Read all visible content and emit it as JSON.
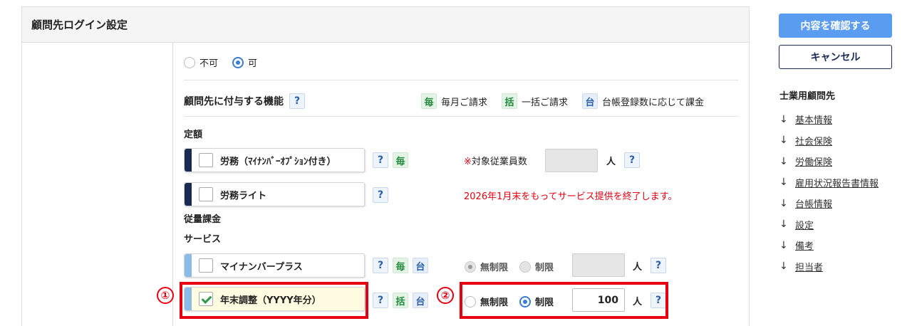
{
  "panel": {
    "title": "顧問先ログイン設定"
  },
  "login_options": {
    "disabled_label": "不可",
    "enabled_label": "可",
    "selected": "可"
  },
  "features": {
    "label": "顧問先に付与する機能",
    "legend": [
      {
        "badge": "毎",
        "text": "毎月ご請求",
        "color": "#1f8a3a"
      },
      {
        "badge": "括",
        "text": "一括ご請求",
        "color": "#1f8a3a"
      },
      {
        "badge": "台",
        "text": "台帳登録数に応じて課金",
        "color": "#2a5fa8"
      }
    ]
  },
  "sections": {
    "fixed": "定額",
    "metered": "従量課金",
    "service": "サービス"
  },
  "services": {
    "roumu": {
      "label": "労務（ﾏｲﾅﾝﾊﾞｰｵﾌﾟｼｮﾝ付き）",
      "checked": false,
      "bar_color": "#1b2a52"
    },
    "roumu_lite": {
      "label": "労務ライト",
      "checked": false,
      "bar_color": "#1b2a52"
    },
    "mynumber": {
      "label": "マイナンバープラス",
      "checked": false,
      "bar_color": "#8bbce6"
    },
    "nenmatsu": {
      "label": "年末調整（YYYY年分）",
      "checked": true,
      "bar_color": "#8bbce6"
    }
  },
  "badges": {
    "monthly": "毎",
    "lump": "括",
    "ledger": "台",
    "help": "?"
  },
  "employee_count": {
    "mark": "※",
    "label": "対象従業員数",
    "unit": "人"
  },
  "notice": "2026年1月末をもってサービス提供を終了します。",
  "limit_options": {
    "unlimited": "無制限",
    "limited": "制限",
    "unit": "人"
  },
  "mynumber_limit": {
    "selected": "無制限",
    "value": ""
  },
  "nenmatsu_limit": {
    "selected": "制限",
    "value": "100"
  },
  "annotations": {
    "one": "①",
    "two": "②",
    "color": "#e60012"
  },
  "sidebar": {
    "confirm": "内容を確認する",
    "cancel": "キャンセル",
    "nav_title": "士業用顧問先",
    "arrow": "↓",
    "items": [
      "基本情報",
      "社会保険",
      "労働保険",
      "雇用状況報告書情報",
      "台帳情報",
      "設定",
      "備考",
      "担当者"
    ]
  }
}
